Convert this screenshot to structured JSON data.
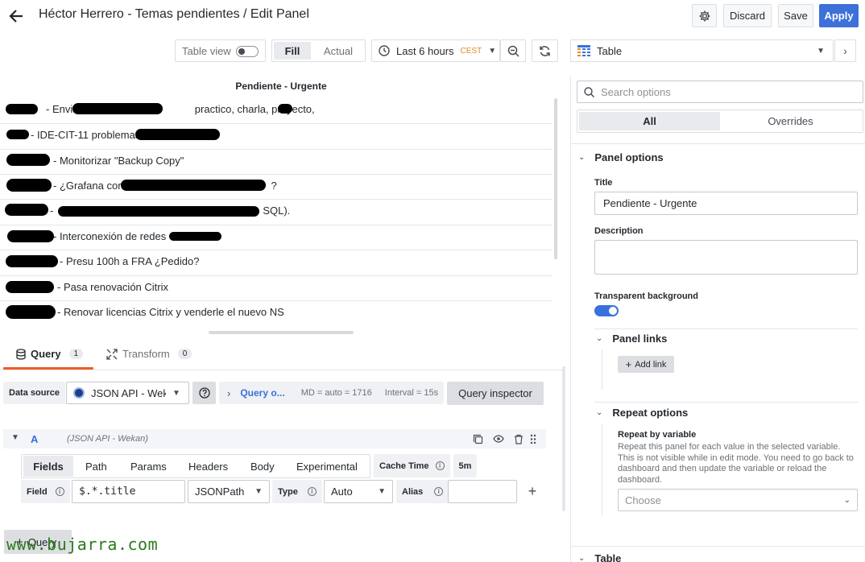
{
  "header": {
    "title": "Héctor Herrero - Temas pendientes / Edit Panel",
    "discard_label": "Discard",
    "save_label": "Save",
    "apply_label": "Apply"
  },
  "toolbar": {
    "table_view_label": "Table view",
    "fill_label": "Fill",
    "actual_label": "Actual",
    "time_range": "Last 6 hours",
    "timezone": "CEST"
  },
  "viz_picker": {
    "selected": "Table"
  },
  "panel": {
    "title": "Pendiente - Urgente",
    "rows": [
      "- Enviar",
      "practico, charla, proyecto,",
      "- IDE-CIT-11 problemas",
      "- Monitorizar \"Backup Copy\"",
      "- ¿Grafana con",
      "?",
      "SQL).",
      "- Interconexión de redes",
      "- Presu 100h a FRA ¿Pedido?",
      "- Pasa renovación Citrix",
      "- Renovar licencias Citrix y venderle el nuevo NS"
    ]
  },
  "query_tabs": {
    "query_label": "Query",
    "query_count": "1",
    "transform_label": "Transform",
    "transform_count": "0"
  },
  "datasource_row": {
    "label": "Data source",
    "value": "JSON API - Wekan",
    "query_options_label": "Query o...",
    "md_info": "MD = auto = 1716",
    "interval_info": "Interval = 15s",
    "inspector_label": "Query inspector"
  },
  "query_a": {
    "ref": "A",
    "source_hint": "(JSON API - Wekan)",
    "subtabs": [
      "Fields",
      "Path",
      "Params",
      "Headers",
      "Body",
      "Experimental"
    ],
    "cache_time_label": "Cache Time",
    "cache_time_value": "5m",
    "field_label": "Field",
    "field_value": "$.*.title",
    "field_type": "JSONPath",
    "type_label": "Type",
    "type_value": "Auto",
    "alias_label": "Alias",
    "alias_value": ""
  },
  "add_query_label": "Query",
  "watermark": "www.bujarra.com",
  "options": {
    "search_placeholder": "Search options",
    "tab_all": "All",
    "tab_overrides": "Overrides",
    "panel_options_label": "Panel options",
    "title_label": "Title",
    "title_value": "Pendiente - Urgente",
    "description_label": "Description",
    "description_value": "",
    "transparent_label": "Transparent background",
    "transparent_on": true,
    "panel_links_label": "Panel links",
    "add_link_label": "Add link",
    "repeat_options_label": "Repeat options",
    "repeat_by_label": "Repeat by variable",
    "repeat_help": "Repeat this panel for each value in the selected variable. This is not visible while in edit mode. You need to go back to dashboard and then update the variable or reload the dashboard.",
    "repeat_placeholder": "Choose",
    "table_section_label": "Table"
  },
  "colors": {
    "accent": "#3871dc",
    "apply_bg": "#3d71d9",
    "cest": "#e28a2c",
    "toggle_on": "#3871dc"
  }
}
